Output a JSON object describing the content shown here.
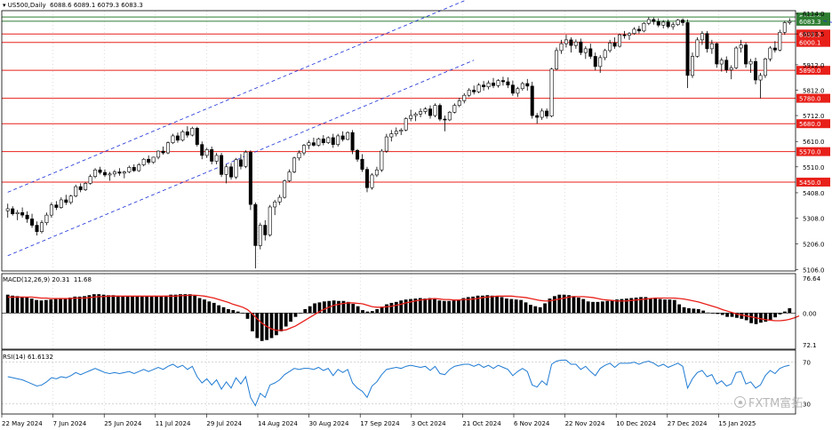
{
  "header": {
    "symbol": "US500,Daily",
    "ohlc": [
      "6088.6",
      "6089.1",
      "6079.3",
      "6083.3"
    ]
  },
  "indicators": {
    "macd_label": "MACD(12,26,9) 20.31  11.68",
    "rsi_label": "RSI(14) 61.6132"
  },
  "watermark": "FXTM富拓",
  "colors": {
    "up_candle": "#ffffff",
    "down_candle": "#000000",
    "candle_outline": "#000000",
    "resistance": "#e8201a",
    "resistance_highlight": "#2e7d32",
    "channel": "#1a2fd6",
    "macd_histogram": "#000000",
    "macd_signal": "#e8201a",
    "rsi_line": "#1f7bd3",
    "grid_dots": "#bdbdbd"
  },
  "chart_data": {
    "type": "candlestick",
    "symbol": "US500",
    "timeframe": "Daily",
    "price_axis_labels": [
      "6114.0",
      "6033.5",
      "5912.0",
      "5812.0",
      "5712.0",
      "5610.0",
      "5510.0",
      "5408.0",
      "5308.0",
      "5206.0",
      "5106.0"
    ],
    "ylim": [
      5100,
      6125
    ],
    "x_tick_labels": [
      "22 May 2024",
      "7 Jun 2024",
      "25 Jun 2024",
      "11 Jul 2024",
      "29 Jul 2024",
      "14 Aug 2024",
      "30 Aug 2024",
      "17 Sep 2024",
      "3 Oct 2024",
      "21 Oct 2024",
      "6 Nov 2024",
      "22 Nov 2024",
      "10 Dec 2024",
      "27 Dec 2024",
      "15 Jan 2025"
    ],
    "horizontal_levels": [
      {
        "value": 6100.0,
        "label": "6100.0",
        "highlight": true
      },
      {
        "value": 6083.3,
        "label": "6083.3",
        "highlight": true
      },
      {
        "value": 6033.0,
        "label": "6033.0"
      },
      {
        "value": 6000.1,
        "label": "6000.1"
      },
      {
        "value": 5890.0,
        "label": "5890.0"
      },
      {
        "value": 5780.0,
        "label": "5780.0"
      },
      {
        "value": 5680.0,
        "label": "5680.0"
      },
      {
        "value": 5570.0,
        "label": "5570.0"
      },
      {
        "value": 5450.0,
        "label": "5450.0"
      }
    ],
    "trendlines": [
      {
        "style": "dashed",
        "from": {
          "bar": 0,
          "price": 5410
        },
        "to": {
          "bar": 96,
          "price": 6180
        }
      },
      {
        "style": "dashed",
        "from": {
          "bar": 0,
          "price": 5160
        },
        "to": {
          "bar": 96,
          "price": 5930
        }
      },
      {
        "style": "solid",
        "from": {
          "bar": 170,
          "price": 5820
        },
        "to": {
          "bar": 245,
          "price": 5685
        }
      },
      {
        "style": "dashed",
        "from": {
          "bar": 168,
          "price": 6085
        },
        "to": {
          "bar": 245,
          "price": 5810
        }
      }
    ],
    "candles": [
      [
        5337,
        5365,
        5310,
        5345
      ],
      [
        5345,
        5355,
        5318,
        5325
      ],
      [
        5325,
        5340,
        5300,
        5330
      ],
      [
        5330,
        5350,
        5310,
        5320
      ],
      [
        5320,
        5335,
        5290,
        5305
      ],
      [
        5305,
        5325,
        5270,
        5280
      ],
      [
        5280,
        5295,
        5240,
        5255
      ],
      [
        5255,
        5300,
        5248,
        5290
      ],
      [
        5290,
        5330,
        5280,
        5320
      ],
      [
        5320,
        5370,
        5310,
        5360
      ],
      [
        5360,
        5375,
        5340,
        5350
      ],
      [
        5350,
        5390,
        5345,
        5380
      ],
      [
        5380,
        5400,
        5360,
        5370
      ],
      [
        5370,
        5400,
        5362,
        5395
      ],
      [
        5395,
        5440,
        5390,
        5432
      ],
      [
        5432,
        5445,
        5410,
        5420
      ],
      [
        5420,
        5450,
        5415,
        5445
      ],
      [
        5445,
        5480,
        5440,
        5472
      ],
      [
        5472,
        5505,
        5465,
        5498
      ],
      [
        5498,
        5510,
        5480,
        5488
      ],
      [
        5488,
        5500,
        5470,
        5478
      ],
      [
        5478,
        5490,
        5455,
        5482
      ],
      [
        5482,
        5498,
        5470,
        5490
      ],
      [
        5490,
        5505,
        5475,
        5485
      ],
      [
        5485,
        5495,
        5465,
        5490
      ],
      [
        5490,
        5515,
        5485,
        5508
      ],
      [
        5508,
        5520,
        5490,
        5495
      ],
      [
        5495,
        5525,
        5490,
        5518
      ],
      [
        5518,
        5545,
        5512,
        5540
      ],
      [
        5540,
        5555,
        5520,
        5528
      ],
      [
        5528,
        5550,
        5522,
        5548
      ],
      [
        5548,
        5575,
        5540,
        5572
      ],
      [
        5572,
        5590,
        5558,
        5565
      ],
      [
        5565,
        5610,
        5560,
        5605
      ],
      [
        5605,
        5640,
        5600,
        5632
      ],
      [
        5632,
        5645,
        5605,
        5615
      ],
      [
        5615,
        5655,
        5610,
        5648
      ],
      [
        5648,
        5670,
        5625,
        5635
      ],
      [
        5635,
        5668,
        5630,
        5662
      ],
      [
        5662,
        5668,
        5590,
        5598
      ],
      [
        5598,
        5610,
        5540,
        5555
      ],
      [
        5555,
        5585,
        5545,
        5578
      ],
      [
        5578,
        5590,
        5520,
        5532
      ],
      [
        5532,
        5565,
        5520,
        5555
      ],
      [
        5555,
        5565,
        5470,
        5480
      ],
      [
        5480,
        5520,
        5445,
        5510
      ],
      [
        5510,
        5525,
        5460,
        5470
      ],
      [
        5470,
        5545,
        5462,
        5538
      ],
      [
        5538,
        5560,
        5500,
        5512
      ],
      [
        5512,
        5575,
        5505,
        5568
      ],
      [
        5568,
        5575,
        5340,
        5362
      ],
      [
        5362,
        5370,
        5110,
        5200
      ],
      [
        5200,
        5290,
        5185,
        5280
      ],
      [
        5280,
        5300,
        5220,
        5242
      ],
      [
        5242,
        5360,
        5235,
        5352
      ],
      [
        5352,
        5380,
        5320,
        5372
      ],
      [
        5372,
        5400,
        5360,
        5390
      ],
      [
        5390,
        5460,
        5385,
        5455
      ],
      [
        5455,
        5500,
        5450,
        5490
      ],
      [
        5490,
        5550,
        5485,
        5545
      ],
      [
        5545,
        5575,
        5535,
        5565
      ],
      [
        5565,
        5600,
        5555,
        5595
      ],
      [
        5595,
        5615,
        5580,
        5605
      ],
      [
        5605,
        5625,
        5590,
        5595
      ],
      [
        5595,
        5625,
        5590,
        5620
      ],
      [
        5620,
        5635,
        5595,
        5605
      ],
      [
        5605,
        5630,
        5600,
        5625
      ],
      [
        5625,
        5640,
        5585,
        5598
      ],
      [
        5598,
        5640,
        5590,
        5632
      ],
      [
        5632,
        5650,
        5610,
        5618
      ],
      [
        5618,
        5650,
        5615,
        5645
      ],
      [
        5645,
        5655,
        5560,
        5575
      ],
      [
        5575,
        5580,
        5530,
        5540
      ],
      [
        5540,
        5560,
        5490,
        5500
      ],
      [
        5500,
        5510,
        5410,
        5428
      ],
      [
        5428,
        5485,
        5420,
        5478
      ],
      [
        5478,
        5510,
        5470,
        5498
      ],
      [
        5498,
        5580,
        5490,
        5572
      ],
      [
        5572,
        5640,
        5565,
        5628
      ],
      [
        5628,
        5655,
        5610,
        5640
      ],
      [
        5640,
        5665,
        5630,
        5650
      ],
      [
        5650,
        5662,
        5635,
        5655
      ],
      [
        5655,
        5705,
        5650,
        5700
      ],
      [
        5700,
        5735,
        5690,
        5712
      ],
      [
        5712,
        5725,
        5690,
        5718
      ],
      [
        5718,
        5740,
        5705,
        5728
      ],
      [
        5728,
        5745,
        5718,
        5738
      ],
      [
        5738,
        5752,
        5700,
        5712
      ],
      [
        5712,
        5760,
        5705,
        5752
      ],
      [
        5752,
        5760,
        5690,
        5698
      ],
      [
        5698,
        5712,
        5650,
        5695
      ],
      [
        5695,
        5730,
        5690,
        5725
      ],
      [
        5725,
        5760,
        5720,
        5752
      ],
      [
        5752,
        5782,
        5745,
        5770
      ],
      [
        5770,
        5800,
        5760,
        5792
      ],
      [
        5792,
        5820,
        5785,
        5812
      ],
      [
        5812,
        5830,
        5795,
        5805
      ],
      [
        5805,
        5840,
        5800,
        5832
      ],
      [
        5832,
        5848,
        5810,
        5825
      ],
      [
        5825,
        5850,
        5815,
        5840
      ],
      [
        5840,
        5860,
        5820,
        5830
      ],
      [
        5830,
        5855,
        5822,
        5850
      ],
      [
        5850,
        5865,
        5830,
        5845
      ],
      [
        5845,
        5862,
        5820,
        5832
      ],
      [
        5832,
        5850,
        5790,
        5800
      ],
      [
        5800,
        5825,
        5785,
        5818
      ],
      [
        5818,
        5845,
        5810,
        5838
      ],
      [
        5838,
        5856,
        5810,
        5828
      ],
      [
        5828,
        5845,
        5700,
        5712
      ],
      [
        5712,
        5722,
        5680,
        5705
      ],
      [
        5705,
        5740,
        5695,
        5730
      ],
      [
        5730,
        5740,
        5700,
        5710
      ],
      [
        5710,
        5900,
        5705,
        5895
      ],
      [
        5895,
        5980,
        5890,
        5968
      ],
      [
        5968,
        6010,
        5955,
        5995
      ],
      [
        5995,
        6030,
        5980,
        6010
      ],
      [
        6010,
        6020,
        5960,
        5988
      ],
      [
        5988,
        6012,
        5975,
        6002
      ],
      [
        6002,
        6015,
        5950,
        5960
      ],
      [
        5960,
        5985,
        5935,
        5975
      ],
      [
        5975,
        5995,
        5935,
        5945
      ],
      [
        5945,
        5960,
        5890,
        5905
      ],
      [
        5905,
        5950,
        5880,
        5940
      ],
      [
        5940,
        5975,
        5930,
        5968
      ],
      [
        5968,
        6010,
        5960,
        5998
      ],
      [
        5998,
        6020,
        5975,
        5985
      ],
      [
        5985,
        6035,
        5980,
        6030
      ],
      [
        6030,
        6045,
        6015,
        6028
      ],
      [
        6028,
        6040,
        6010,
        6035
      ],
      [
        6035,
        6060,
        6030,
        6052
      ],
      [
        6052,
        6065,
        6035,
        6045
      ],
      [
        6045,
        6080,
        6040,
        6075
      ],
      [
        6075,
        6100,
        6068,
        6090
      ],
      [
        6090,
        6098,
        6070,
        6082
      ],
      [
        6082,
        6095,
        6060,
        6068
      ],
      [
        6068,
        6088,
        6055,
        6080
      ],
      [
        6080,
        6090,
        6055,
        6062
      ],
      [
        6062,
        6080,
        6050,
        6070
      ],
      [
        6070,
        6092,
        6065,
        6088
      ],
      [
        6088,
        6095,
        6065,
        6078
      ],
      [
        6078,
        6090,
        5820,
        5870
      ],
      [
        5870,
        5960,
        5860,
        5945
      ],
      [
        5945,
        6020,
        5940,
        6010
      ],
      [
        6010,
        6045,
        5990,
        6035
      ],
      [
        6035,
        6045,
        5960,
        5975
      ],
      [
        5975,
        6010,
        5955,
        5995
      ],
      [
        5995,
        6000,
        5900,
        5915
      ],
      [
        5915,
        5940,
        5885,
        5930
      ],
      [
        5930,
        5945,
        5880,
        5892
      ],
      [
        5892,
        5910,
        5855,
        5900
      ],
      [
        5900,
        5985,
        5895,
        5978
      ],
      [
        5978,
        6010,
        5960,
        5990
      ],
      [
        5990,
        6000,
        5900,
        5915
      ],
      [
        5915,
        5935,
        5880,
        5925
      ],
      [
        5925,
        5940,
        5835,
        5852
      ],
      [
        5852,
        5880,
        5780,
        5870
      ],
      [
        5870,
        5940,
        5860,
        5935
      ],
      [
        5935,
        5985,
        5925,
        5978
      ],
      [
        5978,
        6005,
        5960,
        5970
      ],
      [
        5970,
        6050,
        5965,
        6040
      ],
      [
        6040,
        6085,
        6030,
        6078
      ],
      [
        6078,
        6095,
        6070,
        6083
      ]
    ]
  },
  "macd": {
    "label_right_top": "76.64",
    "label_right_zero": "0.00",
    "label_right_bottom": "72.1",
    "ylim": [
      -75,
      78
    ],
    "histogram": [
      38,
      36,
      35,
      34,
      33,
      30,
      27,
      26,
      27,
      28,
      29,
      30,
      31,
      32,
      34,
      34,
      35,
      37,
      39,
      39,
      38,
      37,
      37,
      36,
      35,
      35,
      34,
      34,
      35,
      34,
      34,
      35,
      35,
      36,
      38,
      38,
      39,
      39,
      39,
      36,
      31,
      28,
      24,
      21,
      16,
      12,
      8,
      6,
      3,
      0,
      -12,
      -38,
      -52,
      -58,
      -56,
      -52,
      -46,
      -38,
      -28,
      -18,
      -8,
      0,
      8,
      14,
      20,
      22,
      24,
      25,
      26,
      25,
      25,
      23,
      19,
      14,
      6,
      3,
      4,
      8,
      13,
      18,
      21,
      23,
      26,
      28,
      29,
      30,
      31,
      30,
      31,
      29,
      26,
      25,
      25,
      26,
      28,
      31,
      33,
      34,
      36,
      36,
      37,
      36,
      35,
      33,
      30,
      29,
      28,
      27,
      22,
      17,
      14,
      12,
      20,
      30,
      35,
      38,
      38,
      37,
      35,
      32,
      29,
      24,
      23,
      23,
      24,
      25,
      27,
      28,
      29,
      30,
      31,
      32,
      33,
      33,
      31,
      30,
      29,
      28,
      28,
      27,
      18,
      12,
      10,
      9,
      8,
      5,
      1,
      -1,
      -2,
      -4,
      -8,
      -8,
      -10,
      -12,
      -15,
      -21,
      -23,
      -20,
      -18,
      -16,
      -9,
      -3,
      3,
      10
    ],
    "signal": [
      33,
      33,
      33,
      33,
      33,
      33,
      32,
      31,
      31,
      30,
      30,
      30,
      30,
      30,
      31,
      31,
      31,
      32,
      33,
      34,
      34,
      35,
      35,
      35,
      35,
      35,
      35,
      35,
      35,
      35,
      35,
      35,
      35,
      35,
      35,
      35,
      36,
      36,
      37,
      37,
      36,
      35,
      33,
      31,
      28,
      25,
      22,
      18,
      15,
      12,
      7,
      -2,
      -12,
      -21,
      -28,
      -33,
      -36,
      -36,
      -35,
      -31,
      -27,
      -21,
      -15,
      -9,
      -3,
      3,
      8,
      12,
      16,
      18,
      20,
      21,
      21,
      20,
      19,
      16,
      13,
      12,
      12,
      13,
      14,
      16,
      18,
      21,
      23,
      25,
      27,
      28,
      29,
      30,
      29,
      28,
      28,
      27,
      27,
      28,
      28,
      29,
      30,
      32,
      33,
      34,
      35,
      35,
      35,
      35,
      34,
      33,
      32,
      30,
      28,
      26,
      25,
      25,
      27,
      29,
      31,
      33,
      34,
      34,
      34,
      33,
      32,
      30,
      28,
      27,
      26,
      25,
      25,
      25,
      26,
      27,
      28,
      29,
      30,
      31,
      31,
      31,
      31,
      31,
      30,
      29,
      27,
      25,
      23,
      20,
      17,
      14,
      11,
      7,
      4,
      1,
      -2,
      -4,
      -6,
      -8,
      -10,
      -12,
      -14,
      -15,
      -16,
      -16,
      -15,
      -13,
      -10,
      -6
    ]
  },
  "rsi": {
    "value": "61.6132",
    "right_label_top": "70",
    "right_label_bottom": "30",
    "ylim": [
      20,
      80
    ],
    "values": [
      56,
      55,
      54,
      53,
      51,
      49,
      47,
      48,
      51,
      55,
      54,
      56,
      55,
      57,
      60,
      58,
      60,
      62,
      64,
      62,
      60,
      59,
      60,
      59,
      60,
      61,
      59,
      61,
      63,
      61,
      63,
      65,
      63,
      66,
      68,
      65,
      67,
      63,
      66,
      56,
      50,
      54,
      48,
      53,
      44,
      51,
      45,
      55,
      49,
      56,
      36,
      28,
      40,
      36,
      48,
      50,
      53,
      58,
      61,
      64,
      63,
      64,
      64,
      63,
      65,
      62,
      64,
      57,
      63,
      60,
      63,
      50,
      45,
      42,
      36,
      47,
      51,
      58,
      63,
      64,
      65,
      64,
      66,
      67,
      66,
      65,
      66,
      62,
      66,
      59,
      58,
      63,
      66,
      67,
      68,
      68,
      66,
      68,
      65,
      67,
      64,
      67,
      65,
      63,
      57,
      61,
      64,
      61,
      48,
      46,
      52,
      48,
      68,
      71,
      72,
      72,
      68,
      68,
      63,
      66,
      61,
      57,
      64,
      67,
      69,
      65,
      69,
      69,
      69,
      70,
      68,
      70,
      71,
      69,
      66,
      68,
      65,
      67,
      69,
      66,
      45,
      54,
      60,
      62,
      56,
      58,
      49,
      52,
      47,
      49,
      60,
      61,
      49,
      51,
      45,
      48,
      57,
      62,
      59,
      64,
      66,
      67
    ]
  }
}
